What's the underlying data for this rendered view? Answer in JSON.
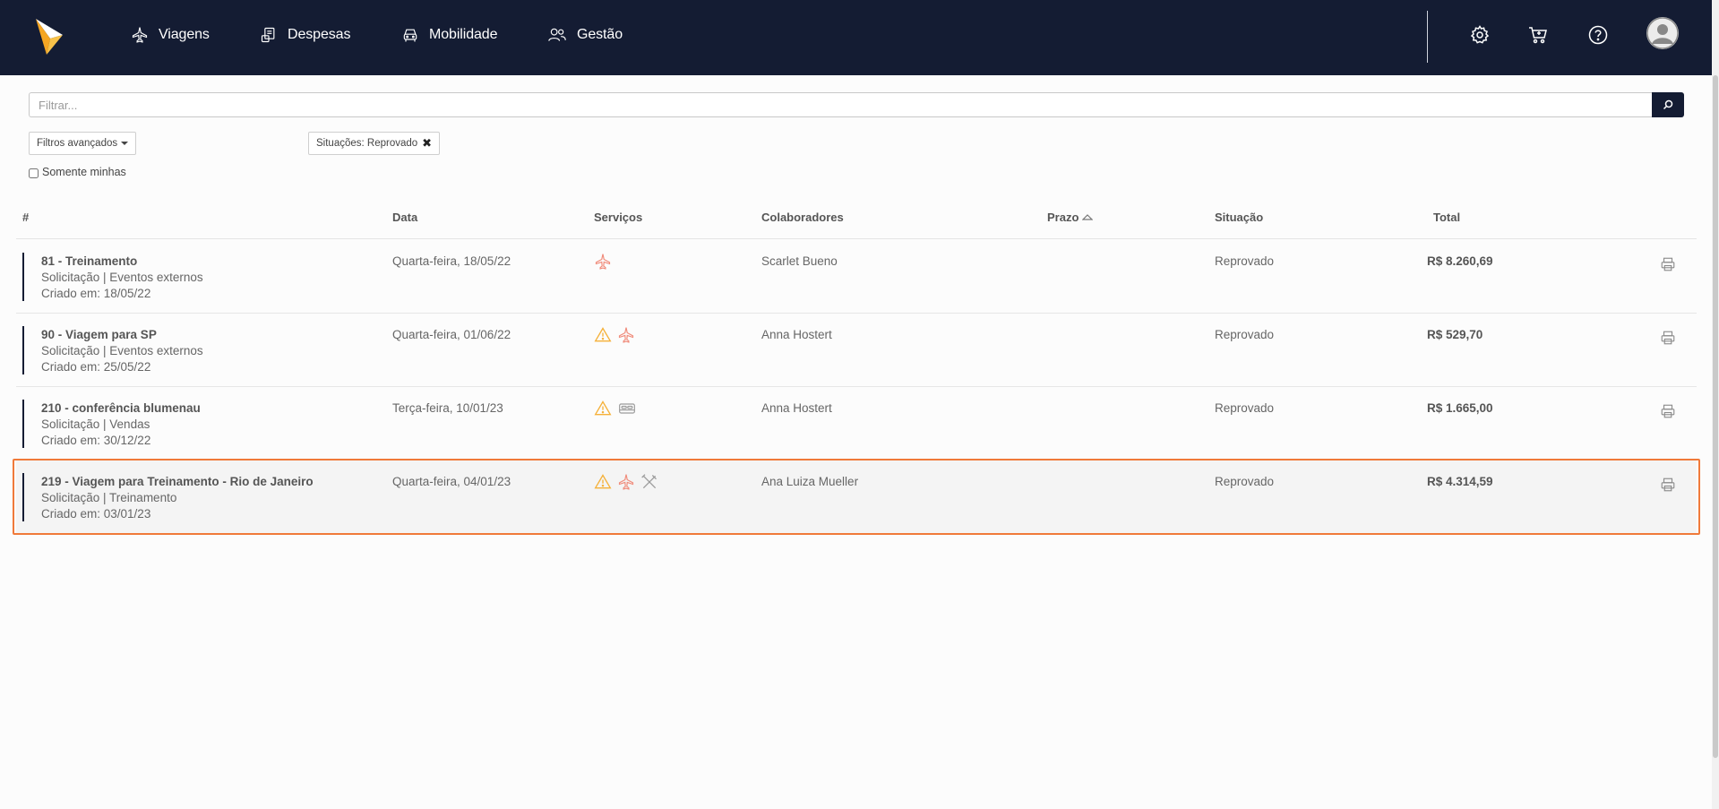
{
  "nav": {
    "items": [
      {
        "label": "Viagens",
        "icon": "plane-icon"
      },
      {
        "label": "Despesas",
        "icon": "receipt-icon"
      },
      {
        "label": "Mobilidade",
        "icon": "car-icon"
      },
      {
        "label": "Gestão",
        "icon": "users-icon"
      }
    ],
    "right_icons": [
      "gear-icon",
      "cart-icon",
      "help-icon",
      "avatar"
    ]
  },
  "search": {
    "placeholder": "Filtrar..."
  },
  "filters": {
    "advanced_label": "Filtros avançados",
    "chip_label": "Situações: Reprovado",
    "chip_close": "✖",
    "only_mine_label": "Somente minhas",
    "only_mine_checked": false
  },
  "table": {
    "headers": {
      "num": "#",
      "date": "Data",
      "services": "Serviços",
      "collaborators": "Colaboradores",
      "deadline": "Prazo",
      "status": "Situação",
      "total": "Total"
    },
    "rows": [
      {
        "title": "81 - Treinamento",
        "subtitle": "Solicitação | Eventos externos",
        "created": "Criado em: 18/05/22",
        "date": "Quarta-feira, 18/05/22",
        "services": [
          "plane-icon"
        ],
        "collaborator": "Scarlet Bueno",
        "deadline": "",
        "status": "Reprovado",
        "total": "R$ 8.260,69",
        "highlighted": false
      },
      {
        "title": "90 - Viagem para SP",
        "subtitle": "Solicitação | Eventos externos",
        "created": "Criado em: 25/05/22",
        "date": "Quarta-feira, 01/06/22",
        "services": [
          "warning-icon",
          "plane-icon"
        ],
        "collaborator": "Anna Hostert",
        "deadline": "",
        "status": "Reprovado",
        "total": "R$ 529,70",
        "highlighted": false
      },
      {
        "title": "210 - conferência blumenau",
        "subtitle": "Solicitação | Vendas",
        "created": "Criado em: 30/12/22",
        "date": "Terça-feira, 10/01/23",
        "services": [
          "warning-icon",
          "bed-icon"
        ],
        "collaborator": "Anna Hostert",
        "deadline": "",
        "status": "Reprovado",
        "total": "R$ 1.665,00",
        "highlighted": false
      },
      {
        "title": "219 - Viagem para Treinamento - Rio de Janeiro",
        "subtitle": "Solicitação | Treinamento",
        "created": "Criado em: 03/01/23",
        "date": "Quarta-feira, 04/01/23",
        "services": [
          "warning-icon",
          "plane-icon",
          "utensils-icon"
        ],
        "collaborator": "Ana Luiza Mueller",
        "deadline": "",
        "status": "Reprovado",
        "total": "R$ 4.314,59",
        "highlighted": true
      }
    ]
  },
  "colors": {
    "navbar": "#141c33",
    "accent": "#f5a623",
    "plane": "#f08b7a",
    "warning": "#f5b13a",
    "selection": "#f07a3a"
  }
}
